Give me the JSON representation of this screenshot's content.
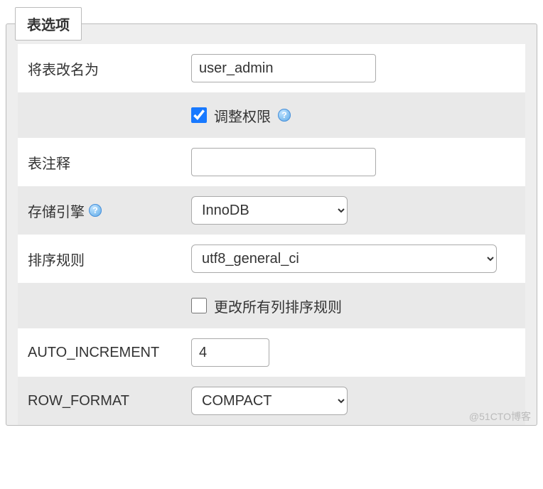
{
  "legend": "表选项",
  "rows": {
    "rename": {
      "label": "将表改名为",
      "value": "user_admin"
    },
    "adjust_priv": {
      "checked": true,
      "label": "调整权限"
    },
    "comment": {
      "label": "表注释",
      "value": ""
    },
    "engine": {
      "label": "存储引擎",
      "value": "InnoDB"
    },
    "collation": {
      "label": "排序规则",
      "value": "utf8_general_ci"
    },
    "change_all_cols": {
      "checked": false,
      "label": "更改所有列排序规则"
    },
    "auto_increment": {
      "label": "AUTO_INCREMENT",
      "value": "4"
    },
    "row_format": {
      "label": "ROW_FORMAT",
      "value": "COMPACT"
    }
  },
  "watermark": "@51CTO博客"
}
